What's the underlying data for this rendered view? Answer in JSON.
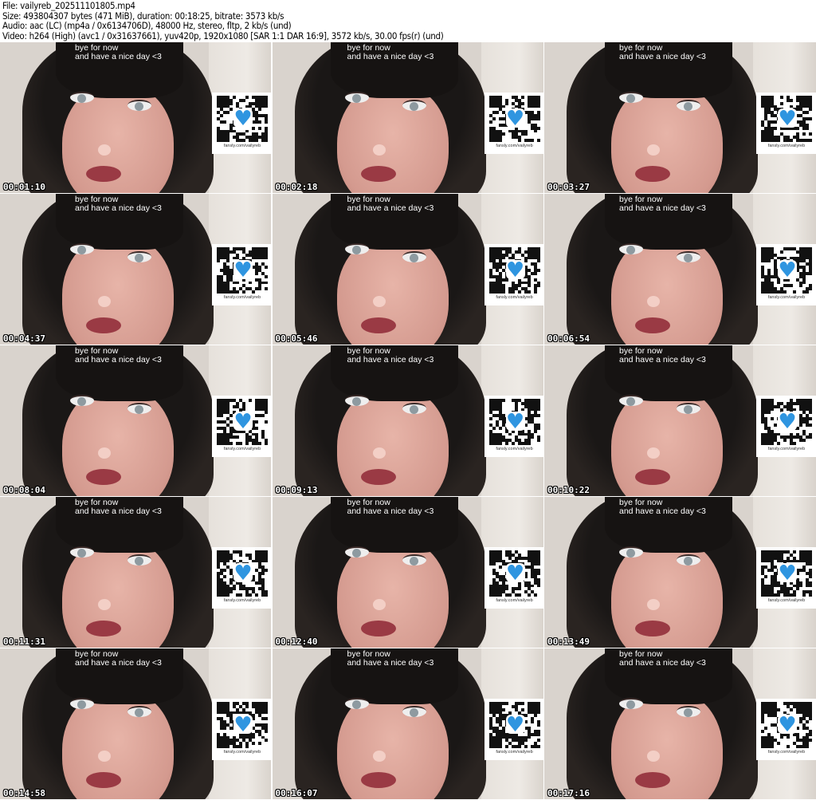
{
  "header": {
    "file": "File: vailyreb_202511101805.mp4",
    "size": "Size: 493804307 bytes (471 MiB), duration: 00:18:25, bitrate: 3573 kb/s",
    "audio": "Audio: aac (LC) (mp4a / 0x6134706D), 48000 Hz, stereo, fltp, 2 kb/s (und)",
    "video": "Video: h264 (High) (avc1 / 0x31637661), yuv420p, 1920x1080 [SAR 1:1 DAR 16:9], 3572 kb/s, 30.00 fps(r) (und)"
  },
  "frame": {
    "caption_line1": "bye for now",
    "caption_line2": "and have a nice day <3",
    "qr_url": "fansly.com/vailyreb",
    "heart_color": "#2f95e0"
  },
  "thumbnails": [
    "00:01:10",
    "00:02:18",
    "00:03:27",
    "00:04:37",
    "00:05:46",
    "00:06:54",
    "00:08:04",
    "00:09:13",
    "00:10:22",
    "00:11:31",
    "00:12:40",
    "00:13:49",
    "00:14:58",
    "00:16:07",
    "00:17:16"
  ]
}
